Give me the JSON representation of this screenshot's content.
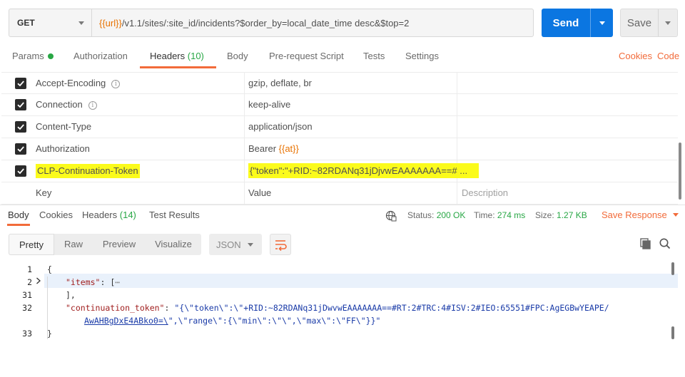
{
  "request": {
    "method": "GET",
    "url_var": "{{url}}",
    "url_rest": "/v1.1/sites/:site_id/incidents?$order_by=local_date_time desc&$top=2",
    "send_label": "Send",
    "save_label": "Save"
  },
  "request_tabs": [
    {
      "label": "Params"
    },
    {
      "label": "Authorization"
    },
    {
      "label": "Headers",
      "count": "(10)"
    },
    {
      "label": "Body"
    },
    {
      "label": "Pre-request Script"
    },
    {
      "label": "Tests"
    },
    {
      "label": "Settings"
    }
  ],
  "request_links": {
    "cookies": "Cookies",
    "code": "Code"
  },
  "headers": [
    {
      "key": "Accept-Encoding",
      "value": "gzip, deflate, br"
    },
    {
      "key": "Connection",
      "value": "keep-alive"
    },
    {
      "key": "Content-Type",
      "value": "application/json"
    },
    {
      "key": "Authorization",
      "value_prefix": "Bearer ",
      "value_var": "{{at}}"
    },
    {
      "key": "CLP-Continuation-Token",
      "value": "{\"token\":\"+RID:~82RDANq31jDjvwEAAAAAAA==# ..."
    }
  ],
  "header_placeholders": {
    "key": "Key",
    "value": "Value",
    "description": "Description"
  },
  "response_tabs": [
    {
      "label": "Body"
    },
    {
      "label": "Cookies"
    },
    {
      "label": "Headers",
      "count": "(14)"
    },
    {
      "label": "Test Results"
    }
  ],
  "response_status": {
    "status_label": "Status:",
    "status_value": "200 OK",
    "time_label": "Time:",
    "time_value": "274 ms",
    "size_label": "Size:",
    "size_value": "1.27 KB",
    "save_response": "Save Response"
  },
  "view_modes": [
    "Pretty",
    "Raw",
    "Preview",
    "Visualize"
  ],
  "format": "JSON",
  "code": {
    "line_numbers": [
      "1",
      "2",
      "31",
      "32",
      "",
      "33"
    ],
    "brace_open": "{",
    "items_key": "\"items\"",
    "items_rest": ": [",
    "items_ellipsis": "⋯",
    "line31": "],",
    "token_key": "\"continuation_token\"",
    "token_colon": ": ",
    "token_val_1": "\"{\\\"token\\\":\\\"+RID:~82RDANq31jDwvwEAAAAAAA==#RT:2#TRC:4#ISV:2#IEO:65551#FPC:AgEGBwYEAPE/",
    "token_val_2_link": "AwAHBgDxE4ABko0=\\",
    "token_val_2_rest": "\",\\\"range\\\":{\\\"min\\\":\\\"\\\",\\\"max\\\":\\\"FF\\\"}}\"",
    "brace_close": "}"
  },
  "colors": {
    "accent": "#f26b3a",
    "send": "#0b76e1",
    "ok": "#28a745",
    "highlight": "#fbfb1c"
  }
}
